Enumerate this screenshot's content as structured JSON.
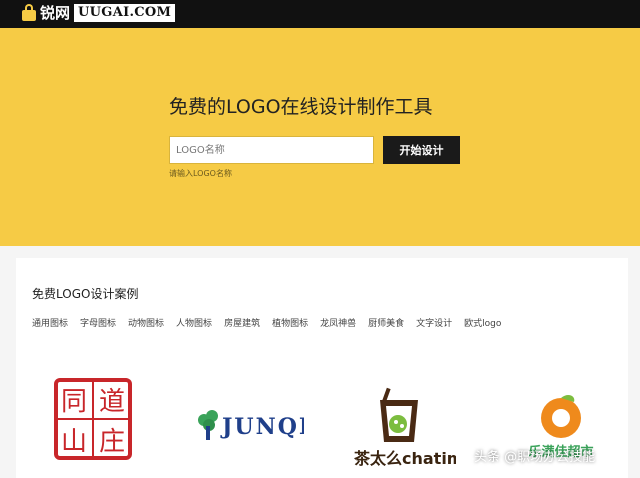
{
  "site": {
    "logo_cn": "锐网",
    "logo_en": "UUGAI.COM"
  },
  "hero": {
    "title": "免费的LOGO在线设计制作工具",
    "input_placeholder": "LOGO名称",
    "input_value": "",
    "button_label": "开始设计",
    "hint": "请输入LOGO名称"
  },
  "cases": {
    "title": "免费LOGO设计案例",
    "categories": [
      "通用图标",
      "字母图标",
      "动物图标",
      "人物图标",
      "房屋建筑",
      "植物图标",
      "龙凤神兽",
      "厨师美食",
      "文字设计",
      "欧式logo"
    ]
  },
  "samples": {
    "s1_text": "同道山庄",
    "s2_text": "JUNQI",
    "s3_cn": "茶太么",
    "s3_en": "chatime",
    "s4_text": "乐满佳超市"
  },
  "watermark": "头条 @职场办公技能",
  "colors": {
    "hero_bg": "#f6cb45",
    "topbar_bg": "#111111",
    "button_bg": "#1a1a1a",
    "seal_red": "#c8262a",
    "tree_green": "#3aa35a",
    "junqi_blue": "#1f3f8a",
    "orange": "#ef8a1c"
  }
}
